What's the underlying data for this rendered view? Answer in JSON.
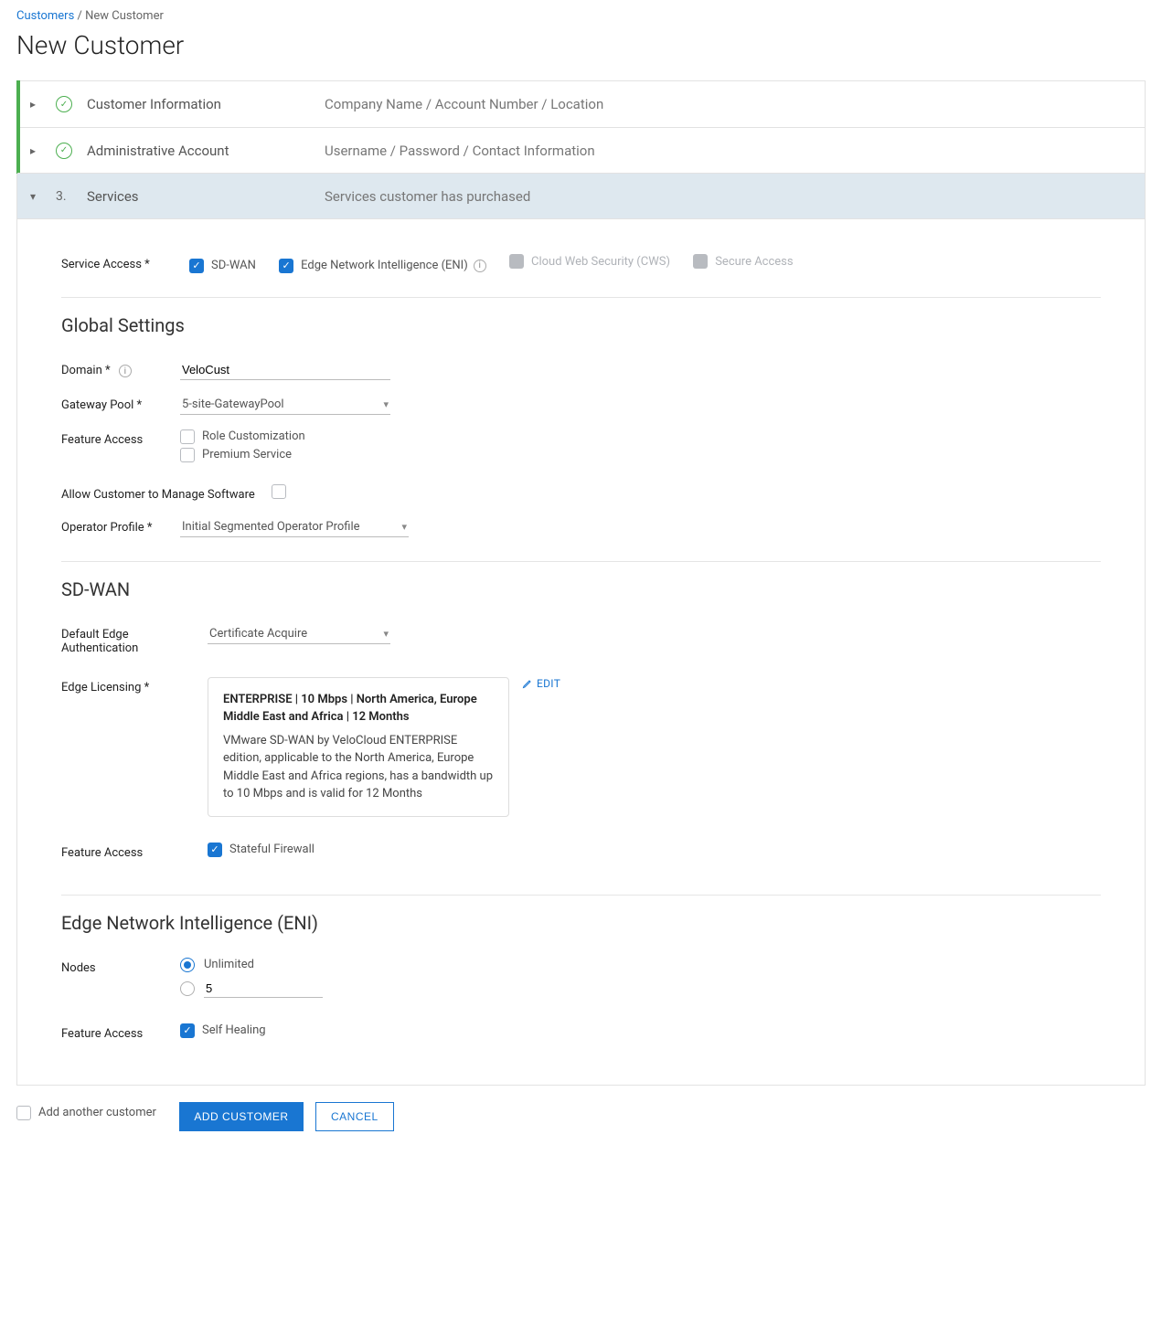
{
  "breadcrumb": {
    "root": "Customers",
    "sep": " / ",
    "current": "New Customer"
  },
  "page_title": "New Customer",
  "steps": {
    "customer_info": {
      "title": "Customer Information",
      "desc": "Company Name / Account Number / Location"
    },
    "admin_account": {
      "title": "Administrative Account",
      "desc": "Username / Password / Contact Information"
    },
    "services": {
      "num": "3.",
      "title": "Services",
      "desc": "Services customer has purchased"
    }
  },
  "service_access": {
    "label": "Service Access *",
    "options": {
      "sdwan": "SD-WAN",
      "eni": "Edge Network Intelligence (ENI)",
      "cws": "Cloud Web Security (CWS)",
      "secure_access": "Secure Access"
    }
  },
  "global": {
    "title": "Global Settings",
    "domain_label": "Domain *",
    "domain_value": "VeloCust",
    "gateway_label": "Gateway Pool *",
    "gateway_value": "5-site-GatewayPool",
    "feature_label": "Feature Access",
    "role_custom": "Role Customization",
    "premium": "Premium Service",
    "allow_manage": "Allow Customer to Manage Software",
    "operator_label": "Operator Profile *",
    "operator_value": "Initial Segmented Operator Profile"
  },
  "sdwan": {
    "title": "SD-WAN",
    "default_edge_label": "Default Edge Authentication",
    "default_edge_value": "Certificate Acquire",
    "edge_license_label": "Edge Licensing *",
    "license_title": "ENTERPRISE | 10 Mbps | North America, Europe Middle East and Africa | 12 Months",
    "license_desc": "VMware SD-WAN by VeloCloud ENTERPRISE edition, applicable to the North America, Europe Middle East and Africa regions, has a bandwidth up to 10 Mbps and is valid for 12 Months",
    "edit": "EDIT",
    "feature_label": "Feature Access",
    "stateful_fw": "Stateful Firewall"
  },
  "eni": {
    "title": "Edge Network Intelligence (ENI)",
    "nodes_label": "Nodes",
    "unlimited": "Unlimited",
    "node_count": "5",
    "feature_label": "Feature Access",
    "self_healing": "Self Healing"
  },
  "footer": {
    "add_another": "Add another customer",
    "add_customer": "ADD CUSTOMER",
    "cancel": "CANCEL"
  }
}
